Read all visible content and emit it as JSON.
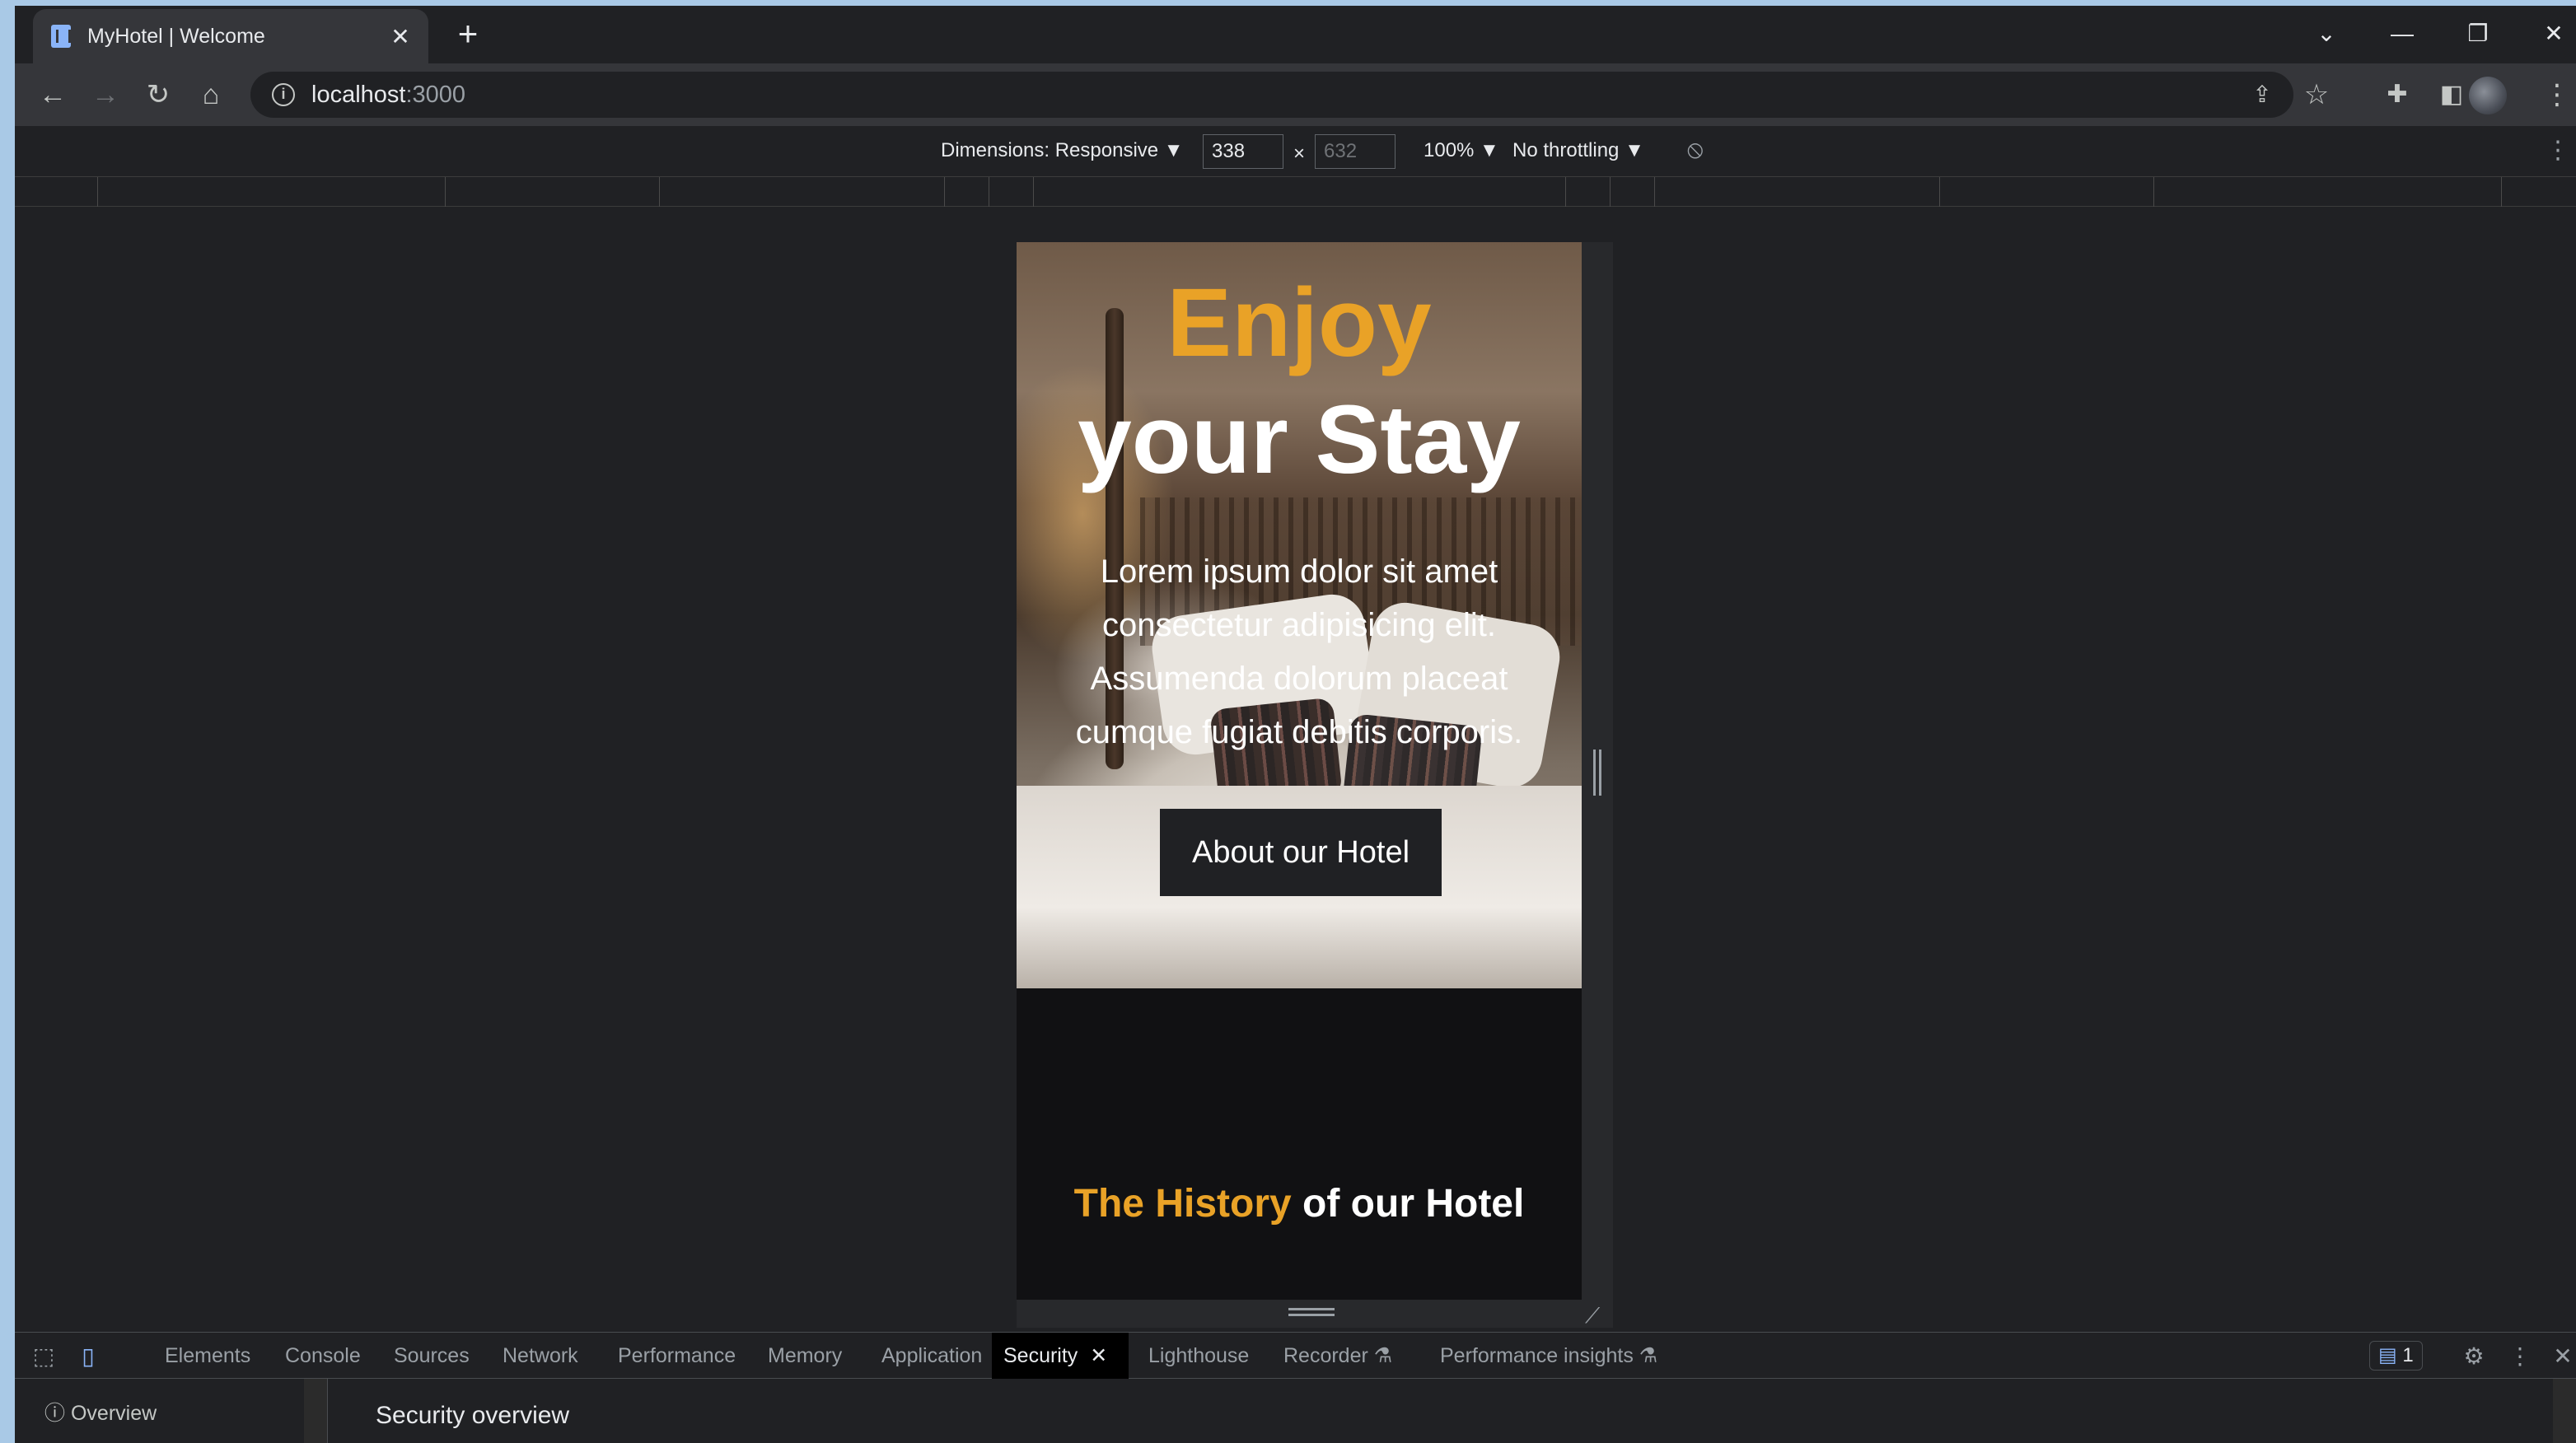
{
  "browser": {
    "tab_title": "MyHotel | Welcome",
    "tab_close": "✕",
    "new_tab": "+",
    "address_host": "localhost",
    "address_port": ":3000"
  },
  "device_toolbar": {
    "dimensions_label": "Dimensions: Responsive ▼",
    "width": "338",
    "height": "632",
    "times": "×",
    "zoom": "100% ▼",
    "throttling": "No throttling ▼"
  },
  "hero": {
    "title_line1": "Enjoy",
    "title_line2": "your Stay",
    "paragraph": "Lorem ipsum dolor sit amet consectetur adipisicing elit. Assumenda dolorum placeat cumque fugiat debitis corporis.",
    "button_label": "About our Hotel"
  },
  "history": {
    "highlight": "The History",
    "rest": " of our Hotel"
  },
  "devtools": {
    "tabs": [
      "Elements",
      "Console",
      "Sources",
      "Network",
      "Performance",
      "Memory",
      "Application",
      "Security",
      "Lighthouse",
      "Recorder",
      "Performance insights"
    ],
    "active_tab": "Security",
    "messages_count": "1",
    "sidebar_item": "Overview",
    "main_title": "Security overview"
  },
  "colors": {
    "accent": "#e9a227",
    "chrome_bg": "#202124",
    "toolbar_bg": "#35363a"
  }
}
